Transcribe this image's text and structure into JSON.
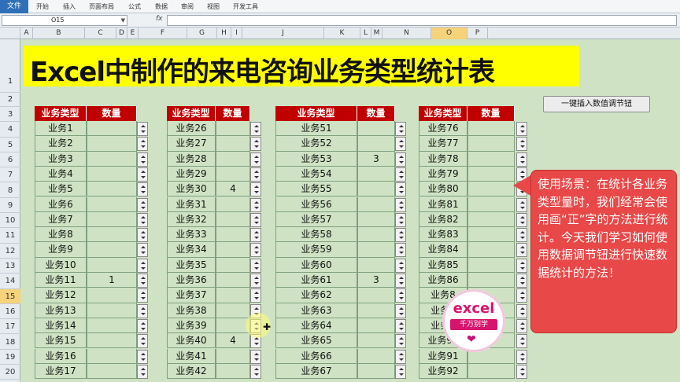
{
  "ribbon": {
    "file": "文件",
    "tabs": [
      "开始",
      "插入",
      "页面布局",
      "公式",
      "数据",
      "审阅",
      "视图",
      "开发工具"
    ]
  },
  "formula_bar": {
    "name_box": "O15",
    "fx": "fx"
  },
  "columns": [
    "A",
    "B",
    "C",
    "D",
    "E",
    "F",
    "G",
    "H",
    "I",
    "J",
    "K",
    "L",
    "M",
    "N",
    "O",
    "P"
  ],
  "selected_column": "O",
  "rows": [
    "1",
    "2",
    "3",
    "4",
    "5",
    "6",
    "7",
    "8",
    "9",
    "10",
    "11",
    "12",
    "13",
    "14",
    "15",
    "16",
    "17",
    "18",
    "19",
    "20"
  ],
  "selected_row": "15",
  "title": "Excel中制作的来电咨询业务类型统计表",
  "button_label": "一键插入数值调节钮",
  "tables": [
    {
      "h1": "业务类型",
      "h2": "数量",
      "rows": [
        [
          "业务1",
          ""
        ],
        [
          "业务2",
          ""
        ],
        [
          "业务3",
          ""
        ],
        [
          "业务4",
          ""
        ],
        [
          "业务5",
          ""
        ],
        [
          "业务6",
          ""
        ],
        [
          "业务7",
          ""
        ],
        [
          "业务8",
          ""
        ],
        [
          "业务9",
          ""
        ],
        [
          "业务10",
          ""
        ],
        [
          "业务11",
          "1"
        ],
        [
          "业务12",
          ""
        ],
        [
          "业务13",
          ""
        ],
        [
          "业务14",
          ""
        ],
        [
          "业务15",
          ""
        ],
        [
          "业务16",
          ""
        ],
        [
          "业务17",
          ""
        ]
      ]
    },
    {
      "h1": "业务类型",
      "h2": "数量",
      "rows": [
        [
          "业务26",
          ""
        ],
        [
          "业务27",
          ""
        ],
        [
          "业务28",
          ""
        ],
        [
          "业务29",
          ""
        ],
        [
          "业务30",
          "4"
        ],
        [
          "业务31",
          ""
        ],
        [
          "业务32",
          ""
        ],
        [
          "业务33",
          ""
        ],
        [
          "业务34",
          ""
        ],
        [
          "业务35",
          ""
        ],
        [
          "业务36",
          ""
        ],
        [
          "业务37",
          ""
        ],
        [
          "业务38",
          ""
        ],
        [
          "业务39",
          ""
        ],
        [
          "业务40",
          "4"
        ],
        [
          "业务41",
          ""
        ],
        [
          "业务42",
          ""
        ]
      ]
    },
    {
      "h1": "业务类型",
      "h2": "数量",
      "rows": [
        [
          "业务51",
          ""
        ],
        [
          "业务52",
          ""
        ],
        [
          "业务53",
          "3"
        ],
        [
          "业务54",
          ""
        ],
        [
          "业务55",
          ""
        ],
        [
          "业务56",
          ""
        ],
        [
          "业务57",
          ""
        ],
        [
          "业务58",
          ""
        ],
        [
          "业务59",
          ""
        ],
        [
          "业务60",
          ""
        ],
        [
          "业务61",
          "3"
        ],
        [
          "业务62",
          ""
        ],
        [
          "业务63",
          ""
        ],
        [
          "业务64",
          ""
        ],
        [
          "业务65",
          ""
        ],
        [
          "业务66",
          ""
        ],
        [
          "业务67",
          ""
        ]
      ]
    },
    {
      "h1": "业务类型",
      "h2": "数量",
      "rows": [
        [
          "业务76",
          ""
        ],
        [
          "业务77",
          ""
        ],
        [
          "业务78",
          ""
        ],
        [
          "业务79",
          ""
        ],
        [
          "业务80",
          ""
        ],
        [
          "业务81",
          ""
        ],
        [
          "业务82",
          ""
        ],
        [
          "业务83",
          ""
        ],
        [
          "业务84",
          ""
        ],
        [
          "业务85",
          ""
        ],
        [
          "业务86",
          ""
        ],
        [
          "业务8",
          ""
        ],
        [
          "业务8",
          ""
        ],
        [
          "业务8",
          ""
        ],
        [
          "业务90",
          ""
        ],
        [
          "业务91",
          ""
        ],
        [
          "业务92",
          ""
        ]
      ]
    }
  ],
  "callout": "使用场景：在统计各业务类型量时，我们经常会使用画“正”字的方法进行统计。今天我们学习如何使用数据调节钮进行快速数据统计的方法！",
  "logo": {
    "line1": "excel",
    "line2": "千万别学"
  }
}
